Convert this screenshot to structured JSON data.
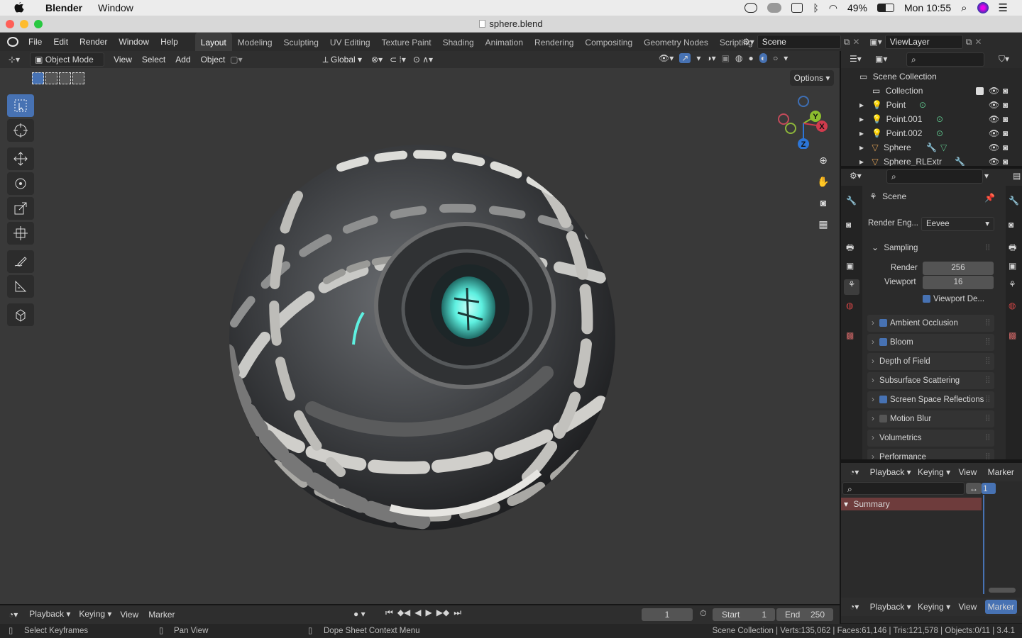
{
  "macos_menubar": {
    "app_name": "Blender",
    "menu_window": "Window",
    "battery": "49%",
    "clock": "Mon 10:55"
  },
  "window": {
    "title": "sphere.blend"
  },
  "topbar": {
    "menus": [
      "File",
      "Edit",
      "Render",
      "Window",
      "Help"
    ],
    "workspaces": [
      "Layout",
      "Modeling",
      "Sculpting",
      "UV Editing",
      "Texture Paint",
      "Shading",
      "Animation",
      "Rendering",
      "Compositing",
      "Geometry Nodes",
      "Scripting"
    ],
    "active_workspace": "Layout",
    "scene_name": "Scene",
    "view_layer": "ViewLayer"
  },
  "viewport_header": {
    "mode": "Object Mode",
    "menus": [
      "View",
      "Select",
      "Add",
      "Object"
    ],
    "transform_orientation": "Global",
    "options_label": "Options"
  },
  "gizmo": {
    "x": "X",
    "y": "Y",
    "z": "Z"
  },
  "outliner": {
    "root": "Scene Collection",
    "items": [
      {
        "name": "Collection",
        "kind": "collection"
      },
      {
        "name": "Point",
        "kind": "light"
      },
      {
        "name": "Point.001",
        "kind": "light"
      },
      {
        "name": "Point.002",
        "kind": "light"
      },
      {
        "name": "Sphere",
        "kind": "mesh"
      },
      {
        "name": "Sphere_RLExtr",
        "kind": "mesh"
      }
    ]
  },
  "properties": {
    "context": "Scene",
    "render_engine_label": "Render Eng...",
    "render_engine": "Eevee",
    "sampling": {
      "title": "Sampling",
      "render_label": "Render",
      "render_value": "256",
      "viewport_label": "Viewport",
      "viewport_value": "16",
      "denoise_label": "Viewport De..."
    },
    "panels": [
      {
        "label": "Ambient Occlusion",
        "checkbox": true
      },
      {
        "label": "Bloom",
        "checkbox": true
      },
      {
        "label": "Depth of Field",
        "checkbox": null
      },
      {
        "label": "Subsurface Scattering",
        "checkbox": null
      },
      {
        "label": "Screen Space Reflections",
        "checkbox": true
      },
      {
        "label": "Motion Blur",
        "checkbox": false
      },
      {
        "label": "Volumetrics",
        "checkbox": null
      },
      {
        "label": "Performance",
        "checkbox": null
      }
    ]
  },
  "dopesheet": {
    "menus": [
      "Playback",
      "Keying",
      "View",
      "Marker"
    ],
    "frame": "1",
    "summary": "Summary"
  },
  "timeline": {
    "menus": [
      "Playback",
      "Keying",
      "View",
      "Marker"
    ],
    "current_frame": "1",
    "start_label": "Start",
    "start": "1",
    "end_label": "End",
    "end": "250"
  },
  "statusbar": {
    "hint1": "Select Keyframes",
    "hint2": "Pan View",
    "hint3": "Dope Sheet Context Menu",
    "stats": "Scene Collection | Verts:135,062 | Faces:61,146 | Tris:121,578 | Objects:0/11 | 3.4.1"
  },
  "colors": {
    "accent": "#4772b3",
    "viewport_bg": "#393939",
    "glow": "#5ef0e0"
  }
}
